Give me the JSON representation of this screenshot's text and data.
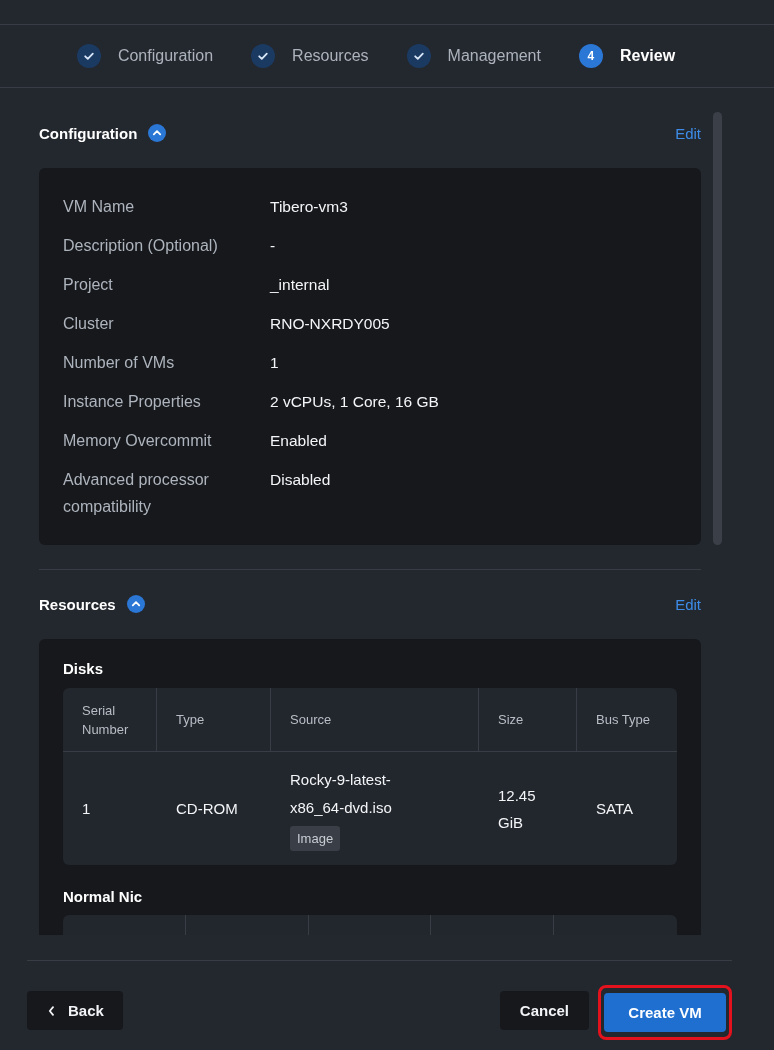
{
  "stepper": {
    "steps": [
      {
        "label": "Configuration",
        "completed": true,
        "selected": false
      },
      {
        "label": "Resources",
        "completed": true,
        "selected": false
      },
      {
        "label": "Management",
        "completed": true,
        "selected": false
      },
      {
        "label": "Review",
        "completed": false,
        "selected": true,
        "number": "4"
      }
    ]
  },
  "sections": [
    {
      "title": "Configuration",
      "expanded": true,
      "edit": "Edit",
      "kind": "fields",
      "fields": [
        {
          "label": "VM Name",
          "value": "Tibero-vm3"
        },
        {
          "label": "Description (Optional)",
          "value": "-"
        },
        {
          "label": "Project",
          "value": "_internal"
        },
        {
          "label": "Cluster",
          "value": "RNO-NXRDY005"
        },
        {
          "label": "Number of VMs",
          "value": "1"
        },
        {
          "label": "Instance Properties",
          "value": "2 vCPUs, 1 Core, 16 GB"
        },
        {
          "label": "Memory Overcommit",
          "value": "Enabled"
        },
        {
          "label": "Advanced processor compatibility",
          "value": "Disabled"
        }
      ]
    },
    {
      "title": "Resources",
      "expanded": true,
      "edit": "Edit",
      "kind": "tables",
      "tables": [
        {
          "title": "Disks",
          "columns": [
            "Serial Number",
            "Type",
            "Source",
            "Size",
            "Bus Type"
          ],
          "rows": [
            {
              "cells": [
                {
                  "text": "1"
                },
                {
                  "text": "CD-ROM"
                },
                {
                  "text": "Rocky-9-latest-x86_64-dvd.iso",
                  "tag": "Image"
                },
                {
                  "text": "12.45 GiB"
                },
                {
                  "text": "SATA"
                }
              ]
            }
          ]
        },
        {
          "title": "Normal Nic"
        }
      ]
    }
  ],
  "footer": {
    "back": "Back",
    "cancel": "Cancel",
    "create": {
      "label": "Create VM",
      "highlighted": true
    }
  }
}
